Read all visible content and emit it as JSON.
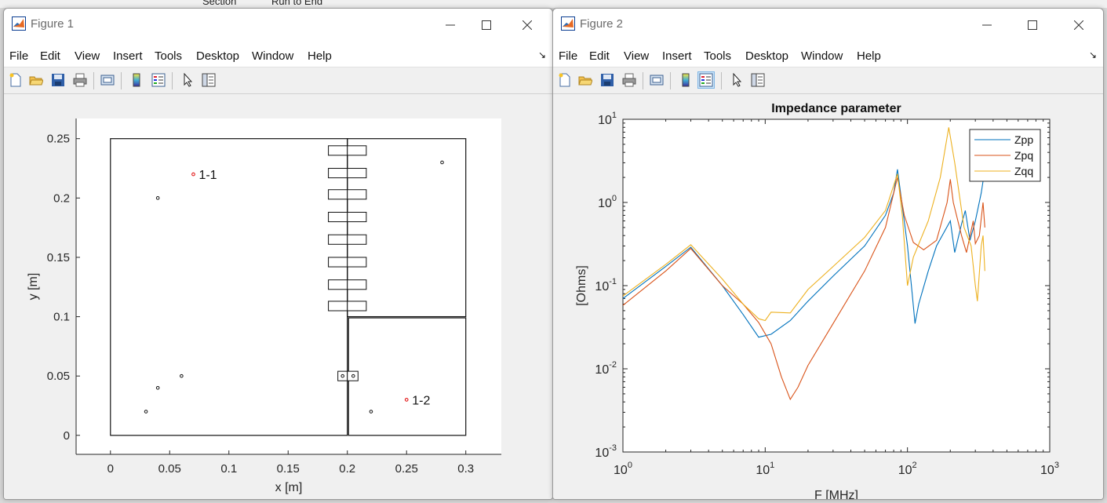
{
  "desktop": {
    "fragments": [
      "Section",
      "Run to End"
    ]
  },
  "menu_items": [
    "File",
    "Edit",
    "View",
    "Insert",
    "Tools",
    "Desktop",
    "Window",
    "Help"
  ],
  "fig1": {
    "title": "Figure 1",
    "xlabel": "x [m]",
    "ylabel": "y [m]",
    "xticks": [
      0,
      0.05,
      0.1,
      0.15,
      0.2,
      0.25,
      0.3
    ],
    "xtick_labels": [
      "0",
      "0.05",
      "0.1",
      "0.15",
      "0.2",
      "0.25",
      "0.3"
    ],
    "yticks": [
      0,
      0.05,
      0.1,
      0.15,
      0.2,
      0.25
    ],
    "ytick_labels": [
      "0",
      "0.05",
      "0.1",
      "0.15",
      "0.2",
      "0.25"
    ],
    "xlim": [
      -0.029,
      0.33
    ],
    "ylim": [
      -0.016,
      0.267
    ],
    "rects": [
      [
        0,
        0,
        0.2,
        0.25
      ],
      [
        0.2,
        0.1,
        0.3,
        0.25
      ],
      [
        0.201,
        0,
        0.3,
        0.099
      ]
    ],
    "small_rects_y": [
      0.24,
      0.221,
      0.203,
      0.184,
      0.165,
      0.146,
      0.127,
      0.109
    ],
    "small_rects_x": [
      0.192,
      0.208
    ],
    "port_rects": [
      [
        0.192,
        0.046,
        0.2,
        0.054
      ],
      [
        0.2,
        0.046,
        0.209,
        0.054
      ]
    ],
    "port_points": [
      [
        0.196,
        0.05
      ],
      [
        0.205,
        0.05
      ]
    ],
    "black_points": [
      [
        0.04,
        0.2
      ],
      [
        0.28,
        0.23
      ],
      [
        0.06,
        0.05
      ],
      [
        0.04,
        0.04
      ],
      [
        0.03,
        0.02
      ],
      [
        0.22,
        0.02
      ]
    ],
    "red_points": [
      {
        "x": 0.07,
        "y": 0.22,
        "label": "1-1"
      },
      {
        "x": 0.25,
        "y": 0.03,
        "label": "1-2"
      }
    ]
  },
  "fig2": {
    "title": "Figure 2",
    "colors": {
      "Zpp": "#0072bd",
      "Zpq": "#d95319",
      "Zqq": "#edb120"
    },
    "chart_data": {
      "type": "line",
      "title": "Impedance parameter",
      "xlabel": "F [MHz]",
      "ylabel": "[Ohms]",
      "xscale": "log",
      "yscale": "log",
      "xlim": [
        1,
        1000
      ],
      "ylim": [
        0.001,
        10
      ],
      "xtick_labels": [
        {
          "base": "10",
          "exp": "0"
        },
        {
          "base": "10",
          "exp": "1"
        },
        {
          "base": "10",
          "exp": "2"
        },
        {
          "base": "10",
          "exp": "3"
        }
      ],
      "ytick_labels": [
        {
          "base": "10",
          "exp": "-3"
        },
        {
          "base": "10",
          "exp": "-2"
        },
        {
          "base": "10",
          "exp": "-1"
        },
        {
          "base": "10",
          "exp": "0"
        },
        {
          "base": "10",
          "exp": "1"
        }
      ],
      "legend_position": "top-right",
      "series": [
        {
          "name": "Zpp",
          "points": [
            [
              1,
              0.07
            ],
            [
              2,
              0.17
            ],
            [
              3,
              0.29
            ],
            [
              5,
              0.1
            ],
            [
              7,
              0.045
            ],
            [
              9,
              0.024
            ],
            [
              11,
              0.026
            ],
            [
              15,
              0.038
            ],
            [
              20,
              0.065
            ],
            [
              30,
              0.13
            ],
            [
              50,
              0.3
            ],
            [
              70,
              0.7
            ],
            [
              80,
              1.3
            ],
            [
              85,
              2.5
            ],
            [
              90,
              1.2
            ],
            [
              100,
              0.3
            ],
            [
              108,
              0.08
            ],
            [
              113,
              0.035
            ],
            [
              120,
              0.06
            ],
            [
              140,
              0.15
            ],
            [
              160,
              0.3
            ],
            [
              200,
              0.6
            ],
            [
              215,
              0.25
            ],
            [
              240,
              0.55
            ],
            [
              255,
              0.8
            ],
            [
              275,
              0.35
            ],
            [
              300,
              0.6
            ],
            [
              330,
              1.3
            ],
            [
              350,
              2.5
            ]
          ]
        },
        {
          "name": "Zpq",
          "points": [
            [
              1,
              0.058
            ],
            [
              2,
              0.15
            ],
            [
              3,
              0.28
            ],
            [
              5,
              0.1
            ],
            [
              7,
              0.06
            ],
            [
              9,
              0.036
            ],
            [
              11,
              0.02
            ],
            [
              13,
              0.008
            ],
            [
              15,
              0.0043
            ],
            [
              17,
              0.006
            ],
            [
              20,
              0.011
            ],
            [
              30,
              0.035
            ],
            [
              50,
              0.15
            ],
            [
              70,
              0.5
            ],
            [
              85,
              2.0
            ],
            [
              95,
              0.7
            ],
            [
              110,
              0.33
            ],
            [
              130,
              0.27
            ],
            [
              160,
              0.35
            ],
            [
              190,
              1.0
            ],
            [
              200,
              1.9
            ],
            [
              210,
              1.0
            ],
            [
              240,
              0.4
            ],
            [
              260,
              0.25
            ],
            [
              290,
              0.6
            ],
            [
              300,
              0.32
            ],
            [
              320,
              0.4
            ],
            [
              340,
              1.0
            ],
            [
              350,
              0.5
            ]
          ]
        },
        {
          "name": "Zqq",
          "points": [
            [
              1,
              0.075
            ],
            [
              2,
              0.18
            ],
            [
              3,
              0.31
            ],
            [
              5,
              0.12
            ],
            [
              7,
              0.06
            ],
            [
              9,
              0.04
            ],
            [
              10,
              0.038
            ],
            [
              11,
              0.048
            ],
            [
              15,
              0.047
            ],
            [
              20,
              0.09
            ],
            [
              30,
              0.17
            ],
            [
              50,
              0.38
            ],
            [
              70,
              0.8
            ],
            [
              85,
              2.2
            ],
            [
              92,
              0.7
            ],
            [
              100,
              0.1
            ],
            [
              110,
              0.22
            ],
            [
              140,
              0.6
            ],
            [
              170,
              2.0
            ],
            [
              195,
              8.0
            ],
            [
              215,
              3.0
            ],
            [
              250,
              0.5
            ],
            [
              280,
              0.3
            ],
            [
              300,
              0.1
            ],
            [
              310,
              0.065
            ],
            [
              330,
              0.3
            ],
            [
              340,
              0.4
            ],
            [
              350,
              0.15
            ]
          ]
        }
      ]
    }
  }
}
